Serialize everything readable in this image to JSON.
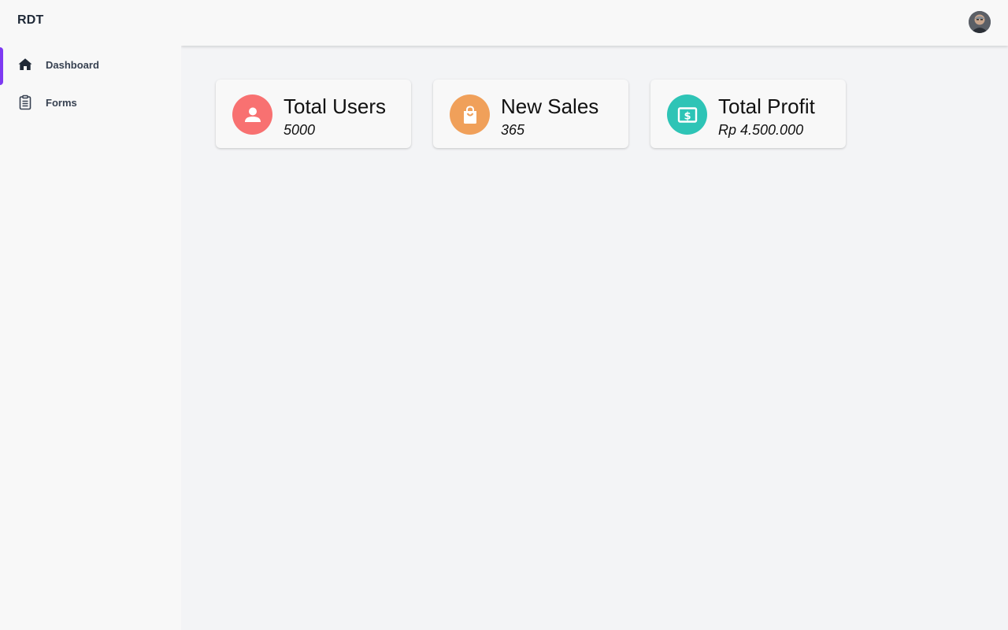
{
  "app": {
    "brand": "RDT"
  },
  "sidebar": {
    "items": [
      {
        "label": "Dashboard",
        "icon": "home-icon",
        "active": true
      },
      {
        "label": "Forms",
        "icon": "clipboard-icon",
        "active": false
      }
    ]
  },
  "header": {
    "avatar": "user-avatar"
  },
  "cards": [
    {
      "title": "Total Users",
      "value": "5000",
      "icon": "user-icon",
      "color": "#f87171"
    },
    {
      "title": "New Sales",
      "value": "365",
      "icon": "shopping-bag-icon",
      "color": "#f0a05a"
    },
    {
      "title": "Total Profit",
      "value": "Rp 4.500.000",
      "icon": "cash-icon",
      "color": "#2ec4b6"
    }
  ],
  "colors": {
    "accent": "#7e3af2",
    "sidebar_bg": "#f8f8f8",
    "main_bg": "#f3f4f6"
  }
}
